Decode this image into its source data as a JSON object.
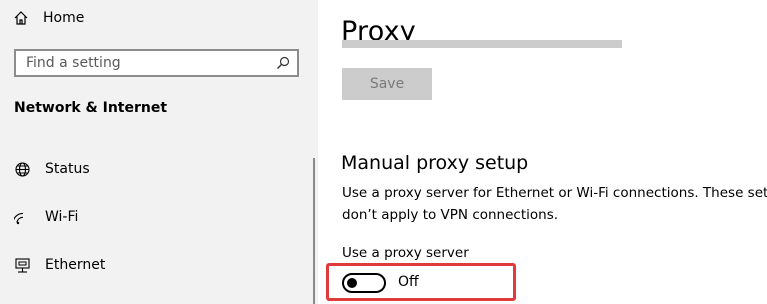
{
  "sidebar": {
    "home_label": "Home",
    "search": {
      "placeholder": "Find a setting",
      "value": ""
    },
    "section_title": "Network & Internet",
    "items": [
      {
        "label": "Status",
        "icon": "globe-icon"
      },
      {
        "label": "Wi-Fi",
        "icon": "wifi-icon"
      },
      {
        "label": "Ethernet",
        "icon": "ethernet-icon"
      }
    ]
  },
  "main": {
    "title": "Proxy",
    "save_label": "Save",
    "manual_section": {
      "heading": "Manual proxy setup",
      "description_line1": "Use a proxy server for Ethernet or Wi-Fi connections. These settings",
      "description_line2": "don’t apply to VPN connections.",
      "toggle_label": "Use a proxy server",
      "toggle_state": "Off",
      "toggle_on": false
    }
  },
  "colors": {
    "sidebar_bg": "#f2f2f2",
    "highlight": "#e03b3b",
    "disabled": "#cccccc"
  }
}
